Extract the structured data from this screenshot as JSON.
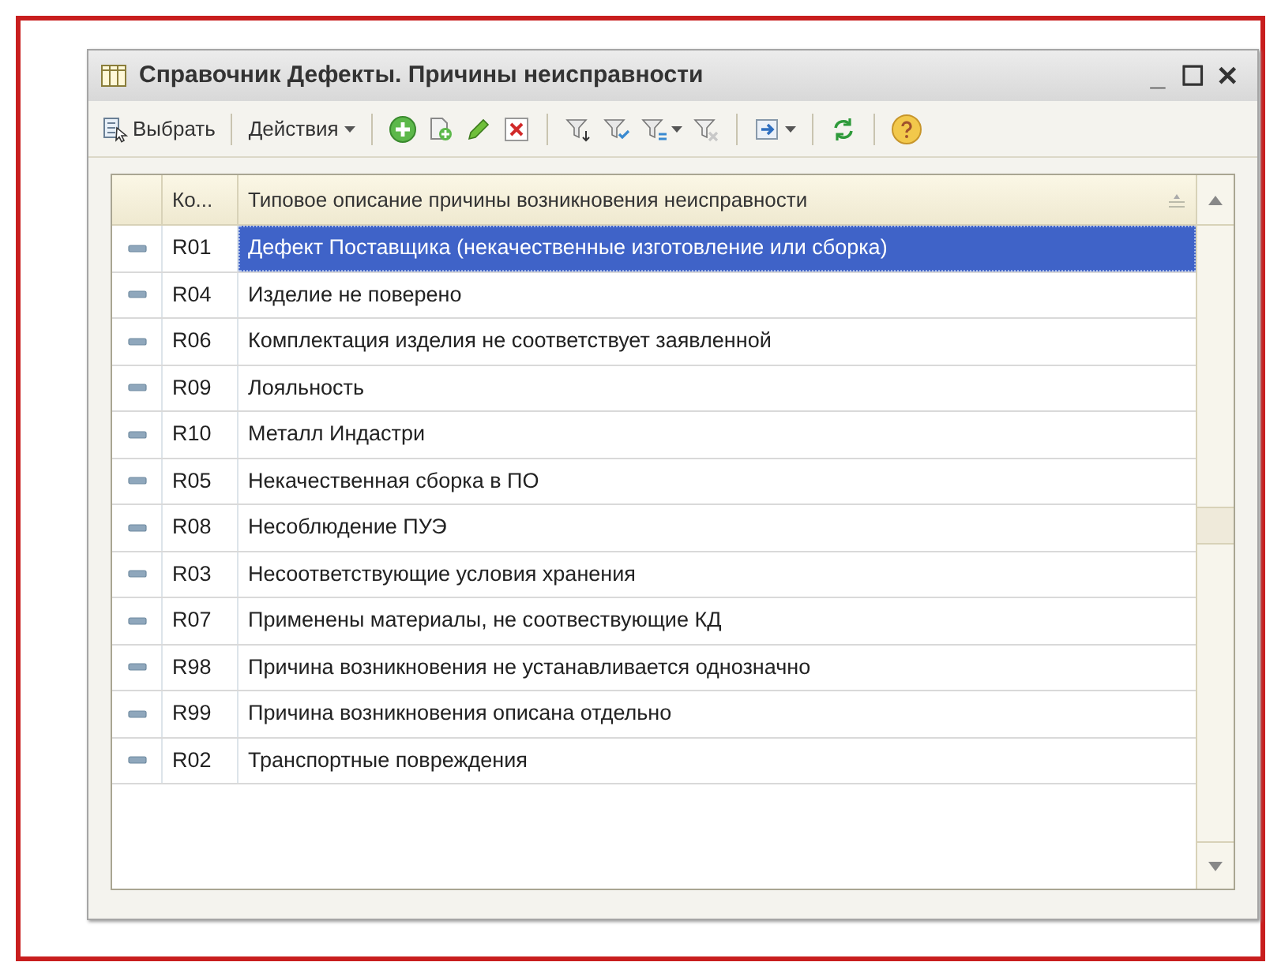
{
  "window": {
    "title": "Справочник Дефекты. Причины неисправности",
    "controls": [
      "_",
      "☐",
      "✕"
    ]
  },
  "toolbar": {
    "select_label": "Выбрать",
    "actions_label": "Действия"
  },
  "table": {
    "columns": [
      "Ко...",
      "Типовое описание причины возникновения неисправности"
    ],
    "rows": [
      {
        "code": "R01",
        "description": "Дефект Поставщика (некачественные изготовление или сборка)",
        "selected": true
      },
      {
        "code": "R04",
        "description": "Изделие не поверено",
        "selected": false
      },
      {
        "code": "R06",
        "description": "Комплектация изделия не соответствует заявленной",
        "selected": false
      },
      {
        "code": "R09",
        "description": "Лояльность",
        "selected": false
      },
      {
        "code": "R10",
        "description": "Металл Индастри",
        "selected": false
      },
      {
        "code": "R05",
        "description": "Некачественная сборка в ПО",
        "selected": false
      },
      {
        "code": "R08",
        "description": "Несоблюдение ПУЭ",
        "selected": false
      },
      {
        "code": "R03",
        "description": "Несоответствующие условия хранения",
        "selected": false
      },
      {
        "code": "R07",
        "description": "Применены материалы, не соотвествующие КД",
        "selected": false
      },
      {
        "code": "R98",
        "description": "Причина возникновения не устанавливается однозначно",
        "selected": false
      },
      {
        "code": "R99",
        "description": "Причина возникновения описана отдельно",
        "selected": false
      },
      {
        "code": "R02",
        "description": "Транспортные повреждения",
        "selected": false
      }
    ]
  }
}
